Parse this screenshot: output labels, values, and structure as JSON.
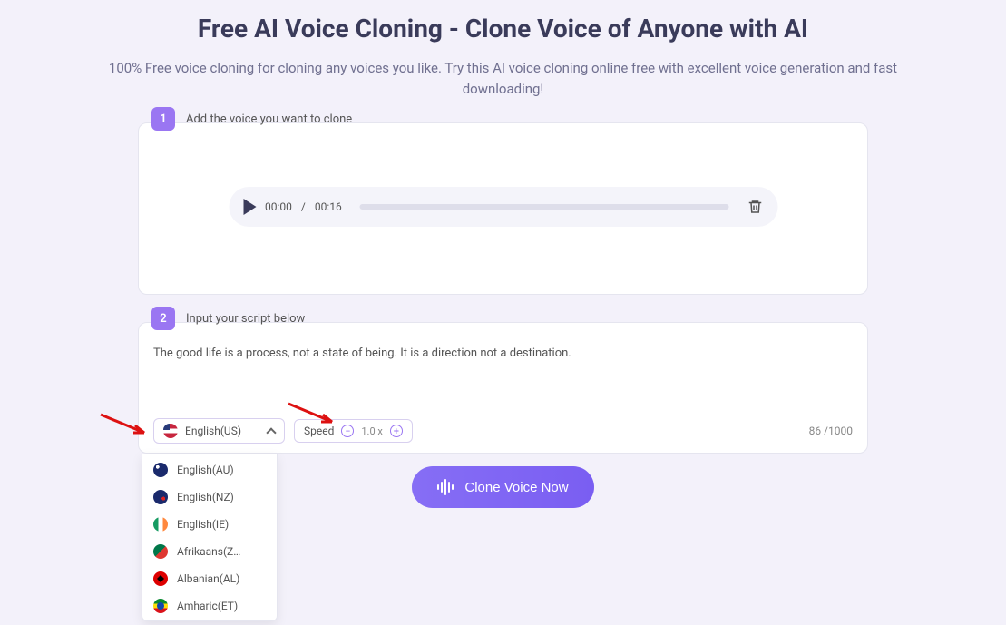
{
  "title": "Free AI Voice Cloning - Clone Voice of Anyone with AI",
  "subtitle": "100% Free voice cloning for cloning any voices you like. Try this AI voice cloning online free with excellent voice generation and fast downloading!",
  "step1": {
    "num": "1",
    "label": "Add the voice you want to clone",
    "currentTime": "00:00",
    "separator": "/",
    "duration": "00:16"
  },
  "step2": {
    "num": "2",
    "label": "Input your script below",
    "script": "The good life is a process, not a state of being. It is a direction not a destination."
  },
  "language": {
    "selected": "English(US)",
    "options": [
      "English(AU)",
      "English(NZ)",
      "English(IE)",
      "Afrikaans(Z…",
      "Albanian(AL)",
      "Amharic(ET)"
    ]
  },
  "speed": {
    "label": "Speed",
    "value": "1.0 x"
  },
  "charCount": {
    "current": "86",
    "sep": " /",
    "max": "1000"
  },
  "cta": "Clone Voice Now"
}
